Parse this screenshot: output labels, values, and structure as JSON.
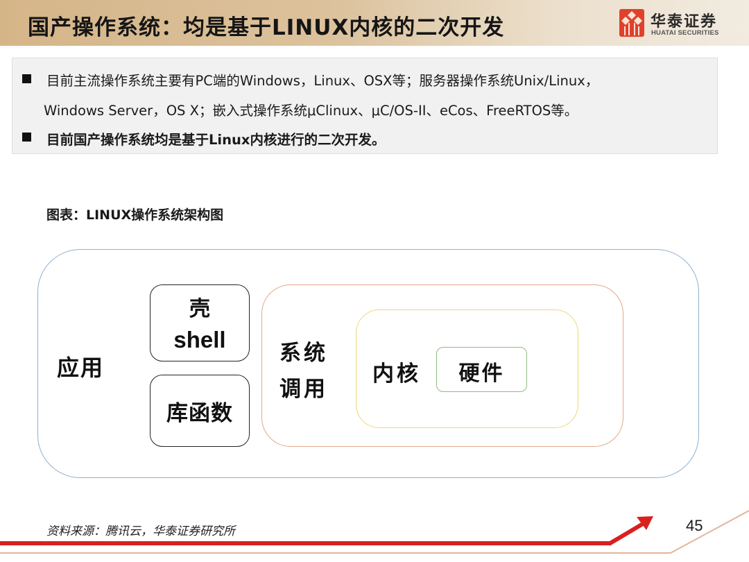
{
  "header": {
    "title": "国产操作系统：均是基于LINUX内核的二次开发",
    "logo": {
      "name_cn": "华泰证券",
      "name_en": "HUATAI SECURITIES",
      "icon": "huatai-logo-icon",
      "color": "#e0412b"
    },
    "background_color": "#d5b588"
  },
  "bullets": [
    {
      "lines": [
        "目前主流操作系统主要有PC端的Windows，Linux、OSX等；服务器操作系统Unix/Linux，",
        "Windows Server，OS X；嵌入式操作系统μClinux、μC/OS-II、eCos、FreeRTOS等。"
      ],
      "bold": false
    },
    {
      "lines": [
        "目前国产操作系统均是基于Linux内核进行的二次开发。"
      ],
      "bold": true
    }
  ],
  "figure": {
    "caption": "图表：LINUX操作系统架构图",
    "layers": {
      "application": {
        "label": "应用",
        "color": "#8fb0cf"
      },
      "shell": {
        "label_cn": "壳",
        "label_en": "shell",
        "color": "#222222"
      },
      "library": {
        "label": "库函数",
        "color": "#222222"
      },
      "syscall": {
        "label_line1": "系统",
        "label_line2": "调用",
        "color": "#e3a987"
      },
      "kernel": {
        "label": "内核",
        "color": "#efd874"
      },
      "hardware": {
        "label": "硬件",
        "color": "#8fba7d"
      }
    }
  },
  "footer": {
    "source": "资料来源：腾讯云，华泰证券研究所",
    "page_number": "45",
    "accent_color": "#d9201f"
  }
}
